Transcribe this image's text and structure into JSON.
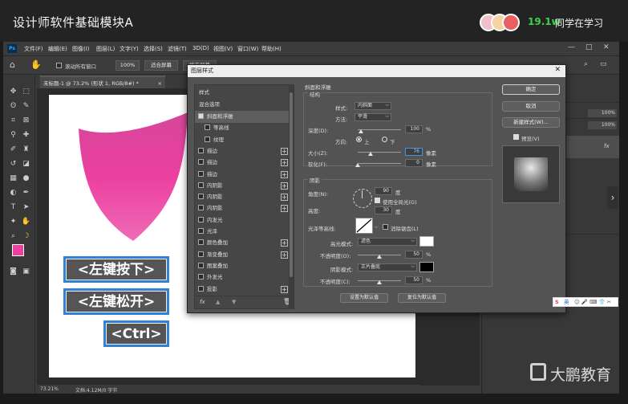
{
  "course": {
    "title": "设计师软件基础模块A",
    "viewer_count": "19.1w",
    "viewer_label": "同学在学习"
  },
  "app": {
    "logo": "Ps",
    "menu": [
      "文件(F)",
      "编辑(E)",
      "图像(I)",
      "图层(L)",
      "文字(Y)",
      "选择(S)",
      "滤镜(T)",
      "3D(D)",
      "视图(V)",
      "窗口(W)",
      "帮助(H)"
    ],
    "window_controls": [
      "—",
      "□",
      "✕"
    ],
    "options": {
      "scroll_all_label": "滚动所有窗口",
      "zoom_value": "100%",
      "fit_screen": "适合屏幕",
      "fill_screen": "填充屏幕"
    },
    "document_tab": "未标题-1 @ 73.2% (形状 1, RGB/8#) *",
    "document_tab_close": "×",
    "status": {
      "zoom": "73.21%",
      "doc": "文档:4.12M/0 字节"
    }
  },
  "canvas": {
    "keys": [
      "<左键按下>",
      "<左键松开>",
      "<Ctrl>"
    ]
  },
  "right_panel": {
    "opacity_values": [
      "100%",
      "100%"
    ],
    "fx": "fx"
  },
  "dialog": {
    "title": "图层样式",
    "close": "✕",
    "styles_header": "样式",
    "blend_options": "混合选项",
    "items": [
      {
        "label": "斜面和浮雕",
        "checked": true,
        "selected": true,
        "plus": false,
        "indent": false
      },
      {
        "label": "等高线",
        "checked": false,
        "selected": false,
        "plus": false,
        "indent": true
      },
      {
        "label": "纹理",
        "checked": false,
        "selected": false,
        "plus": false,
        "indent": true
      },
      {
        "label": "描边",
        "checked": false,
        "selected": false,
        "plus": true,
        "indent": false
      },
      {
        "label": "描边",
        "checked": false,
        "selected": false,
        "plus": true,
        "indent": false
      },
      {
        "label": "描边",
        "checked": false,
        "selected": false,
        "plus": true,
        "indent": false
      },
      {
        "label": "内阴影",
        "checked": false,
        "selected": false,
        "plus": true,
        "indent": false
      },
      {
        "label": "内阴影",
        "checked": false,
        "selected": false,
        "plus": true,
        "indent": false
      },
      {
        "label": "内阴影",
        "checked": false,
        "selected": false,
        "plus": true,
        "indent": false
      },
      {
        "label": "内发光",
        "checked": false,
        "selected": false,
        "plus": false,
        "indent": false
      },
      {
        "label": "光泽",
        "checked": false,
        "selected": false,
        "plus": false,
        "indent": false
      },
      {
        "label": "颜色叠加",
        "checked": false,
        "selected": false,
        "plus": true,
        "indent": false
      },
      {
        "label": "渐变叠加",
        "checked": false,
        "selected": false,
        "plus": true,
        "indent": false
      },
      {
        "label": "图案叠加",
        "checked": false,
        "selected": false,
        "plus": false,
        "indent": false
      },
      {
        "label": "外发光",
        "checked": false,
        "selected": false,
        "plus": false,
        "indent": false
      },
      {
        "label": "投影",
        "checked": false,
        "selected": false,
        "plus": true,
        "indent": false
      }
    ],
    "footer_icons": [
      "fx",
      "▲",
      "▼",
      "🗑"
    ],
    "bevel": {
      "section": "斜面和浮雕",
      "structure": "结构",
      "style_label": "样式:",
      "style_value": "内斜面",
      "method_label": "方法:",
      "method_value": "平滑",
      "depth_label": "深度(D):",
      "depth_value": "100",
      "depth_unit": "%",
      "direction_label": "方向:",
      "dir_up": "上",
      "dir_down": "下",
      "size_label": "大小(Z):",
      "size_value": "76",
      "size_unit": "像素",
      "soften_label": "软化(F):",
      "soften_value": "0",
      "soften_unit": "像素",
      "shading": "阴影",
      "angle_label": "角度(N):",
      "angle_value": "90",
      "angle_unit": "度",
      "global_light": "使用全局光(G)",
      "altitude_label": "高度:",
      "altitude_value": "30",
      "altitude_unit": "度",
      "gloss_label": "光泽等高线:",
      "antialias": "消除锯齿(L)",
      "highlight_label": "高光模式:",
      "highlight_value": "滤色",
      "hl_opacity_label": "不透明度(O):",
      "hl_opacity_value": "50",
      "hl_opacity_unit": "%",
      "shadow_label": "阴影模式:",
      "shadow_value": "正片叠底",
      "sh_opacity_label": "不透明度(C):",
      "sh_opacity_value": "50",
      "sh_opacity_unit": "%",
      "set_default": "设置为默认值",
      "reset_default": "复位为默认值"
    },
    "buttons": {
      "ok": "确定",
      "cancel": "取消",
      "new_style": "新建样式(W)...",
      "preview": "预览(V)"
    }
  },
  "ime": {
    "label": "英"
  },
  "brand": {
    "name": "大鹏教育"
  },
  "colors": {
    "pink": "#ec3fa0",
    "key_border": "#2f82d6",
    "viewer_green": "#3fd14c"
  }
}
